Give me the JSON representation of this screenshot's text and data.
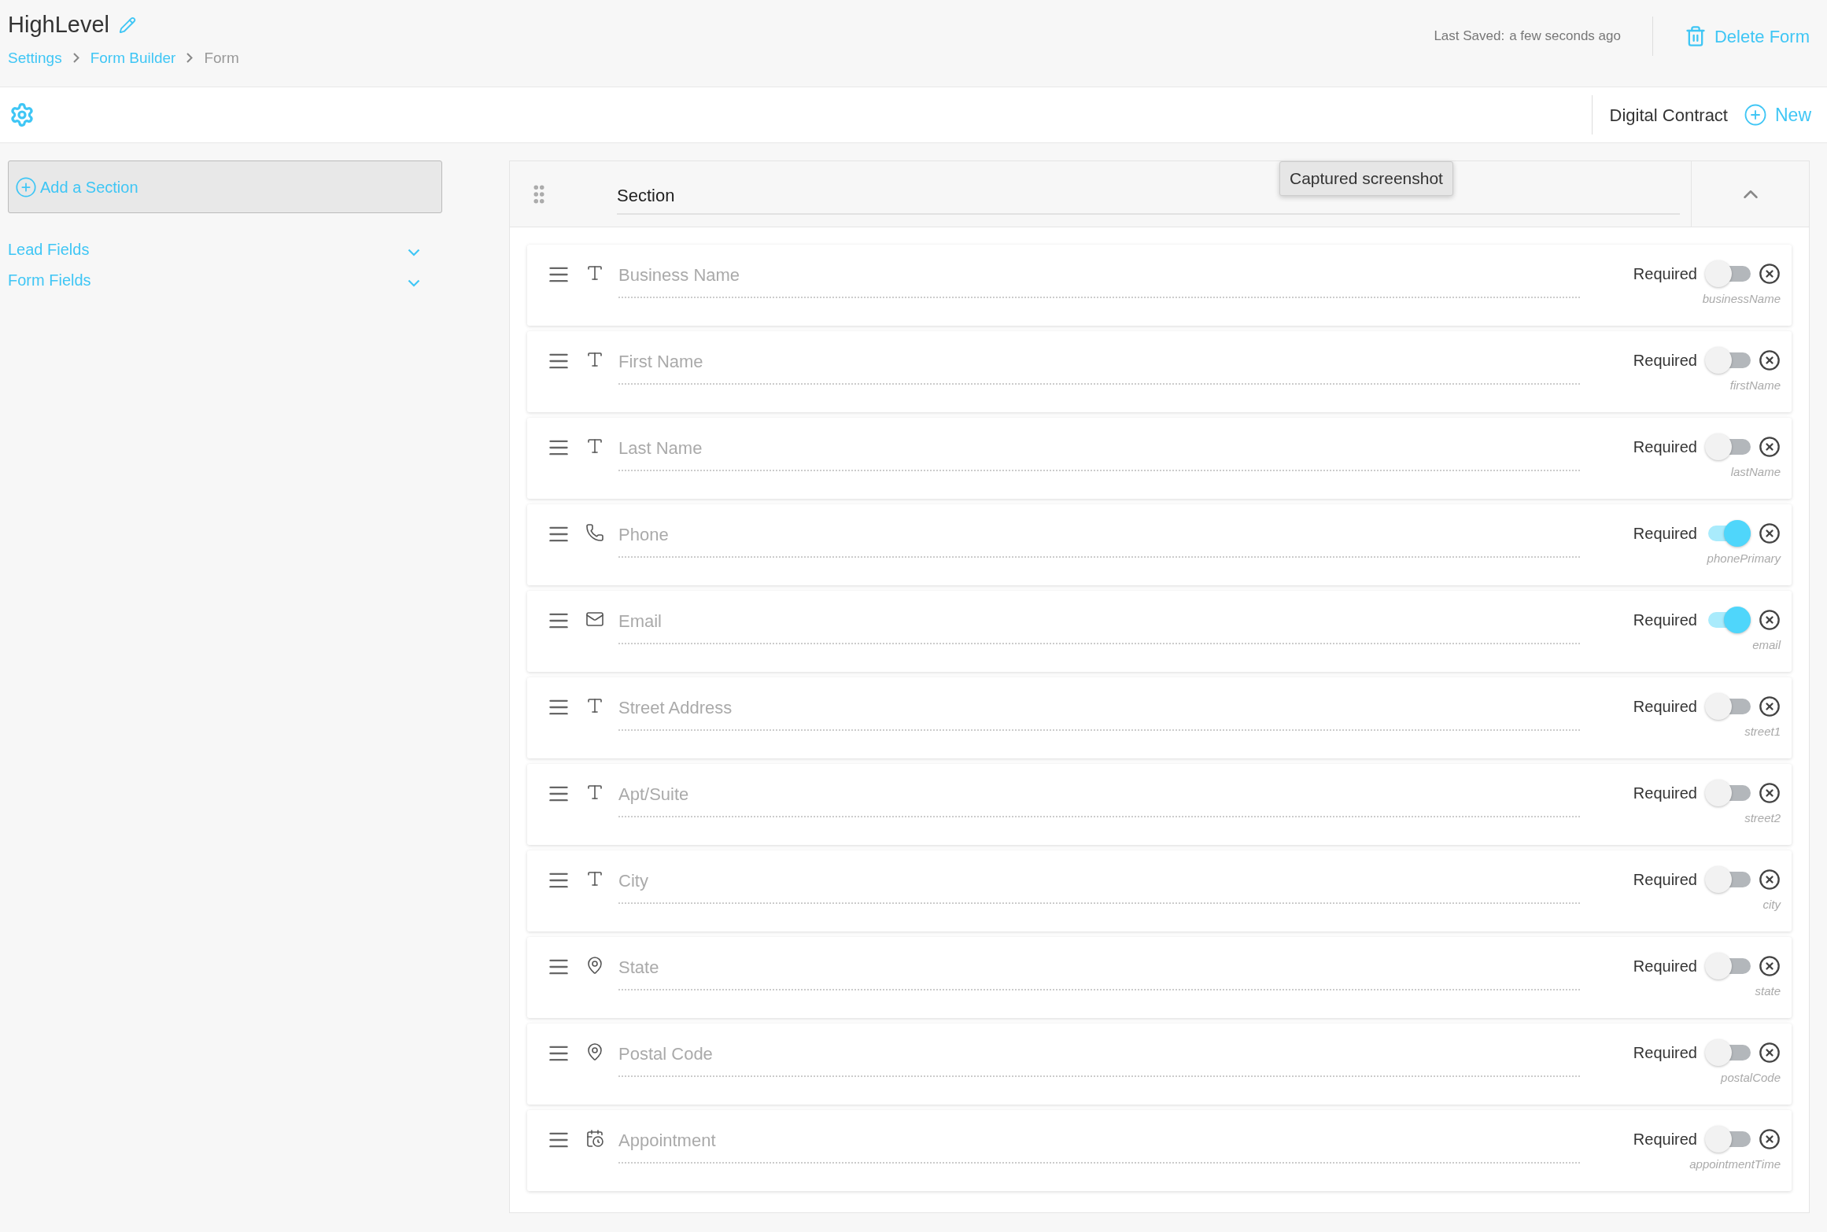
{
  "header": {
    "title": "HighLevel",
    "breadcrumbs": [
      {
        "label": "Settings",
        "kind": "link"
      },
      {
        "label": "Form Builder",
        "kind": "link"
      },
      {
        "label": "Form",
        "kind": "current"
      }
    ],
    "last_saved_label": "Last Saved:",
    "last_saved_value": "a few seconds ago",
    "delete_button": "Delete Form"
  },
  "toolbar": {
    "form_type": "Digital Contract",
    "new_button": "New"
  },
  "sidebar": {
    "add_section": "Add a Section",
    "groups": [
      "Lead Fields",
      "Form Fields"
    ]
  },
  "tooltip": "Captured screenshot",
  "section": {
    "title": "Section"
  },
  "fields": [
    {
      "label": "Business Name",
      "kind": "text",
      "required_label": "Required",
      "required": false,
      "key": "businessName"
    },
    {
      "label": "First Name",
      "kind": "text",
      "required_label": "Required",
      "required": false,
      "key": "firstName"
    },
    {
      "label": "Last Name",
      "kind": "text",
      "required_label": "Required",
      "required": false,
      "key": "lastName"
    },
    {
      "label": "Phone",
      "kind": "phone",
      "required_label": "Required",
      "required": true,
      "key": "phonePrimary"
    },
    {
      "label": "Email",
      "kind": "email",
      "required_label": "Required",
      "required": true,
      "key": "email"
    },
    {
      "label": "Street Address",
      "kind": "text",
      "required_label": "Required",
      "required": false,
      "key": "street1"
    },
    {
      "label": "Apt/Suite",
      "kind": "text",
      "required_label": "Required",
      "required": false,
      "key": "street2"
    },
    {
      "label": "City",
      "kind": "text",
      "required_label": "Required",
      "required": false,
      "key": "city"
    },
    {
      "label": "State",
      "kind": "location",
      "required_label": "Required",
      "required": false,
      "key": "state"
    },
    {
      "label": "Postal Code",
      "kind": "location",
      "required_label": "Required",
      "required": false,
      "key": "postalCode"
    },
    {
      "label": "Appointment",
      "kind": "date",
      "required_label": "Required",
      "required": false,
      "key": "appointmentTime"
    }
  ]
}
